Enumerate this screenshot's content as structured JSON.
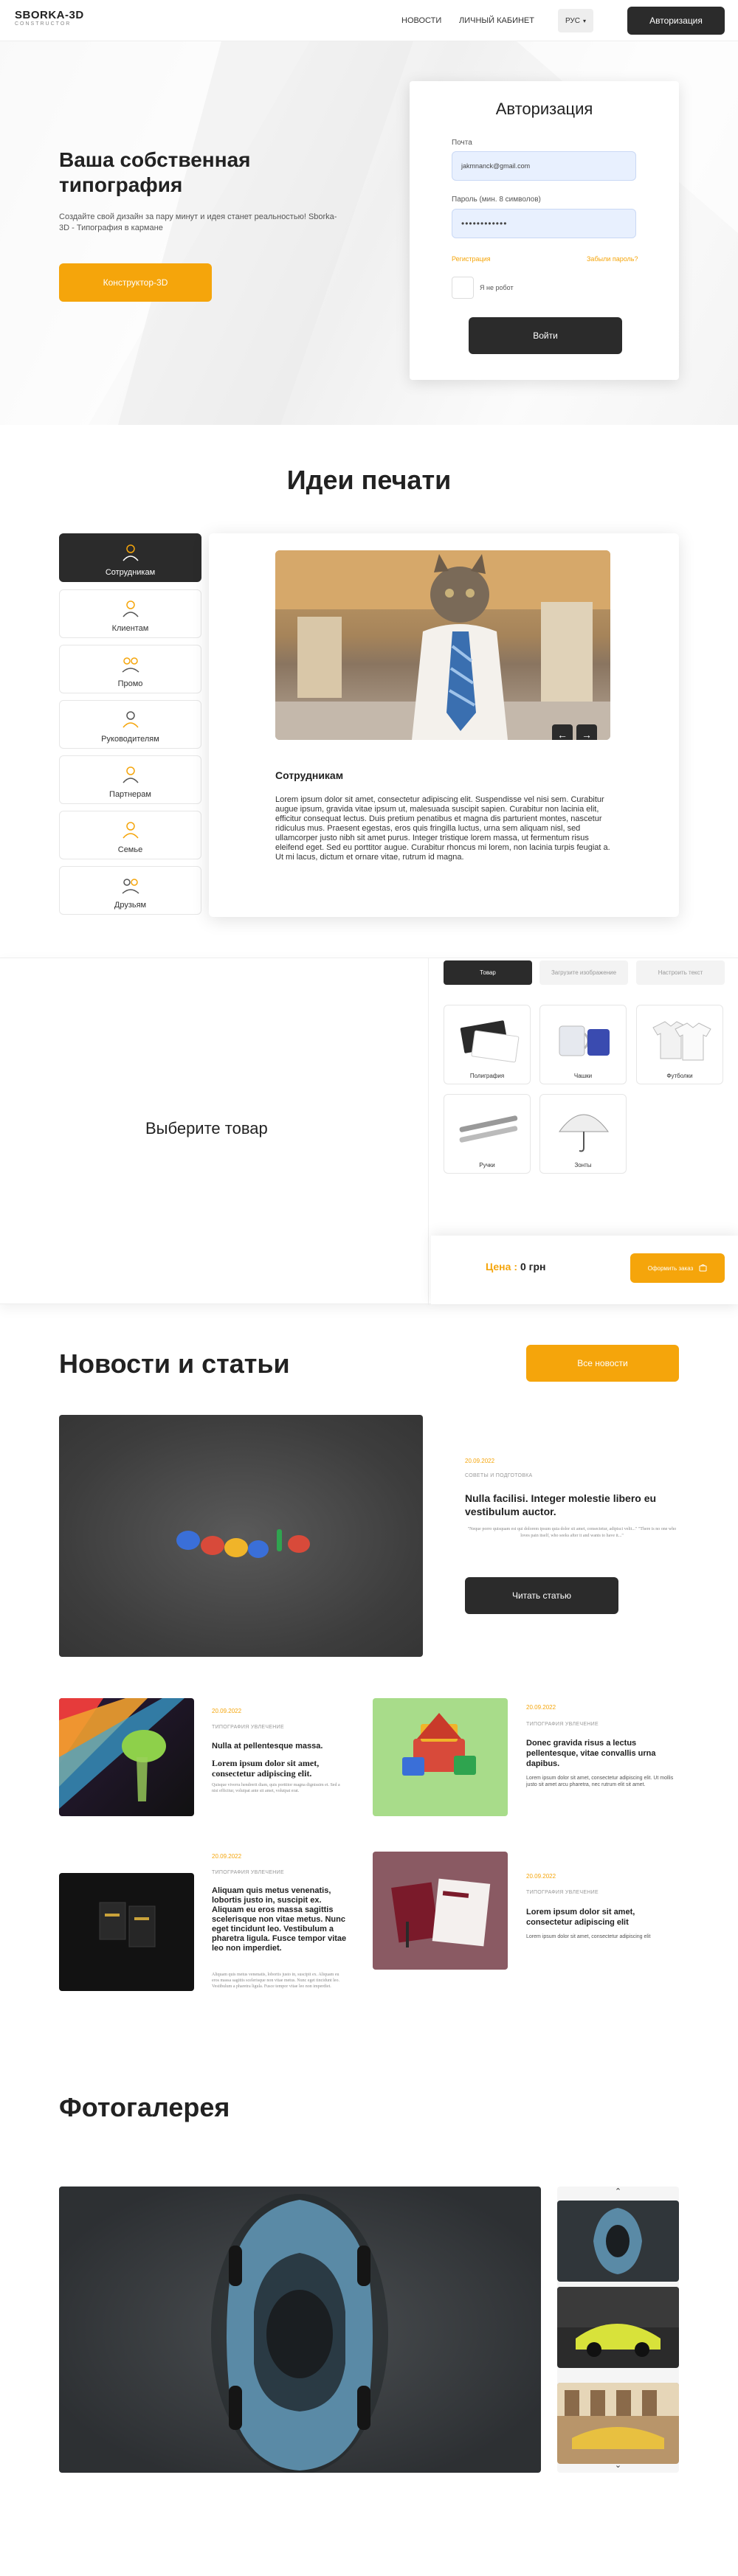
{
  "header": {
    "logo": "SBORKA-3D",
    "logo_sub": "CONSTRUCTOR",
    "nav": [
      "НОВОСТИ",
      "ЛИЧНЫЙ КАБИНЕТ"
    ],
    "lang": "РУС",
    "auth_button": "Авторизация"
  },
  "hero": {
    "title": "Ваша собственная типография",
    "text": "Создайте свой дизайн за пару минут и идея станет реальностью! Sborka-3D - Типография в кармане",
    "cta": "Конструктор-3D"
  },
  "auth": {
    "title": "Авторизация",
    "email_label": "Почта",
    "email_value": "jakmnanck@gmail.com",
    "password_label": "Пароль (мин. 8 символов)",
    "password_value": "••••••••••••",
    "register": "Регистрация",
    "forgot": "Забыли пароль?",
    "remember": "Я не робот",
    "login": "Войти"
  },
  "ideas": {
    "title": "Идеи печати",
    "items": [
      "Сотрудникам",
      "Клиентам",
      "Промо",
      "Руководителям",
      "Партнерам",
      "Семье",
      "Друзьям"
    ],
    "card_title": "Сотрудникам",
    "card_text": "Lorem ipsum dolor sit amet, consectetur adipiscing elit. Suspendisse vel nisi sem. Curabitur augue ipsum, gravida vitae ipsum ut, malesuada suscipit sapien. Curabitur non lacinia elit, efficitur consequat lectus. Duis pretium penatibus et magna dis parturient montes, nascetur ridiculus mus. Praesent egestas, eros quis fringilla luctus, urna sem aliquam nisl, sed ullamcorper justo nibh sit amet purus. Integer tristique lorem massa, ut fermentum risus eleifend eget. Sed eu porttitor augue. Curabitur rhoncus mi lorem, non lacinia turpis feugiat a. Ut mi lacus, dictum et ornare vitae, rutrum id magna.",
    "prev": "←",
    "next": "→"
  },
  "product": {
    "heading": "Выберите товар",
    "tabs": [
      "Товар",
      "Загрузите изображение",
      "Настроить текст"
    ],
    "items": [
      "Полиграфия",
      "Чашки",
      "Футболки",
      "Ручки",
      "Зонты"
    ],
    "price_label": "Цена :",
    "price_value": "0 грн",
    "checkout": "Оформить заказ"
  },
  "news": {
    "title": "Новости и статьи",
    "all_button": "Все новости",
    "featured": {
      "date": "20.09.2022",
      "tag": "СОВЕТЫ И ПОДГОТОВКА",
      "title": "Nulla facilisi. Integer molestie libero eu vestibulum auctor.",
      "excerpt": "\"Neque porro quisquam est qui dolorem ipsum quia dolor sit amet, consectetur, adipisci velit...\" \"There is no one who loves pain itself, who seeks after it and wants to have it...\"",
      "button": "Читать статью"
    },
    "articles": [
      {
        "date": "20.09.2022",
        "tag": "ТИПОГРАФИЯ УВЛЕЧЕНИЕ",
        "title": "Nulla at pellentesque massa.",
        "subtitle": "Lorem ipsum dolor sit amet, consectetur adipiscing elit.",
        "text": "Quisque viverra hendrerit diam, quis porttitor magna dignissim et. Sed a nisi efficitur, volutpat ante sit amet, volutpat erat."
      },
      {
        "date": "20.09.2022",
        "tag": "ТИПОГРАФИЯ УВЛЕЧЕНИЕ",
        "title": "Donec gravida risus a lectus pellentesque, vitae convallis urna dapibus.",
        "subtitle": "",
        "text": "Lorem ipsum dolor sit amet, consectetur adipiscing elit. Ut mollis justo sit amet arcu pharetra, nec rutrum elit sit amet."
      },
      {
        "date": "20.09.2022",
        "tag": "ТИПОГРАФИЯ УВЛЕЧЕНИЕ",
        "title": "Aliquam quis metus venenatis, lobortis justo in, suscipit ex. Aliquam eu eros massa sagittis scelerisque non vitae metus. Nunc eget tincidunt leo. Vestibulum a pharetra ligula. Fusce tempor vitae leo non imperdiet.",
        "subtitle": "",
        "text": "Aliquam quis metus venenatis, lobortis justo in, suscipit ex. Aliquam eu eros massa sagittis scelerisque non vitae metus. Nunc eget tincidunt leo. Vestibulum a pharetra ligula. Fusce tempor vitae leo non imperdiet."
      },
      {
        "date": "20.09.2022",
        "tag": "ТИПОГРАФИЯ УВЛЕЧЕНИЕ",
        "title": "Lorem ipsum dolor sit amet, consectetur adipiscing elit",
        "subtitle": "",
        "text": "Lorem ipsum dolor sit amet, consectetur adipiscing elit"
      }
    ]
  },
  "gallery": {
    "title": "Фотогалерея",
    "up": "⌃",
    "down": "⌄"
  },
  "colors": {
    "accent": "#f5a50b",
    "dark": "#2b2b2b"
  }
}
